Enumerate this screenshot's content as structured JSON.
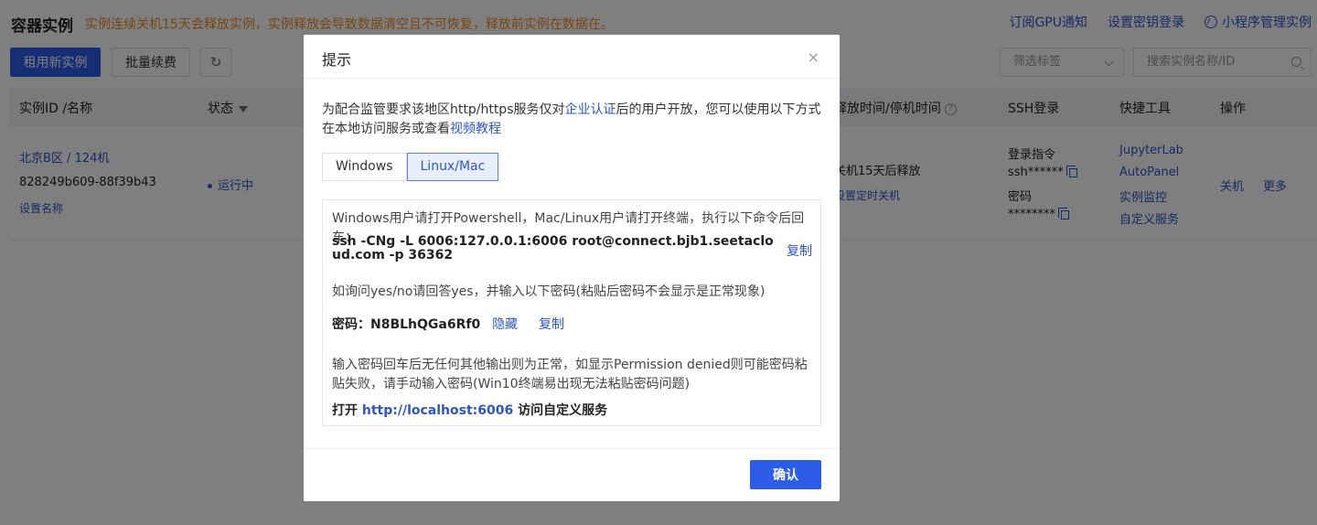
{
  "header": {
    "title": "容器实例",
    "notice": "实例连续关机15天会释放实例，实例释放会导致数据清空且不可恢复，释放前实例在数据在。",
    "links": {
      "gpu_notify": "订阅GPU通知",
      "ssh_key": "设置密钥登录",
      "mini_program": "小程序管理实例"
    }
  },
  "toolbar": {
    "rent_label": "租用新实例",
    "renew_label": "批量续费",
    "refresh_glyph": "↻",
    "tag_filter_placeholder": "筛选标签",
    "search_placeholder": "搜索实例名称/ID"
  },
  "table": {
    "columns": {
      "id_name": "实例ID /名称",
      "status": "状态",
      "release_time": "释放时间/停机时间",
      "ssh": "SSH登录",
      "tools": "快捷工具",
      "actions": "操作"
    },
    "row": {
      "region_name": "北京B区 / 124机",
      "instance_id": "828249b609-88f39b43",
      "set_name": "设置名称",
      "status": "运行中",
      "release_text": "关机15天后释放",
      "set_shutdown": "设置定时关机",
      "ssh_cmd_label": "登录指令",
      "ssh_cmd_mask": "ssh******",
      "ssh_pwd_label": "密码",
      "ssh_pwd_mask": "********",
      "tools": [
        "JupyterLab",
        "AutoPanel",
        "实例监控",
        "自定义服务"
      ],
      "action_shutdown": "关机",
      "action_more": "更多"
    }
  },
  "modal": {
    "title": "提示",
    "close_glyph": "×",
    "intro_part1": "为配合监管要求该地区http/https服务仅对",
    "intro_link1": "企业认证",
    "intro_part2": "后的用户开放，您可以使用以下方式在本地访问服务或查看",
    "intro_link2": "视频教程",
    "tabs": [
      "Windows",
      "Linux/Mac"
    ],
    "active_tab": "Linux/Mac",
    "panel": {
      "step1": "Windows用户请打开Powershell，Mac/Linux用户请打开终端，执行以下命令后回车：",
      "command": "ssh -CNg -L 6006:127.0.0.1:6006 root@connect.bjb1.seetacloud.com -p 36362",
      "copy_label": "复制",
      "step2": "如询问yes/no请回答yes，并输入以下密码(粘贴后密码不会显示是正常现象)",
      "password_label": "密码：",
      "password_value": "N8BLhQGa6Rf0",
      "hide_label": "隐藏",
      "step3": "输入密码回车后无任何其他输出则为正常，如显示Permission denied则可能密码粘贴失败，请手动输入密码(Win10终端易出现无法粘贴密码问题)",
      "open_prefix": "打开",
      "open_url": "http://localhost:6006",
      "open_suffix": "访问自定义服务"
    },
    "ok_label": "确认"
  }
}
